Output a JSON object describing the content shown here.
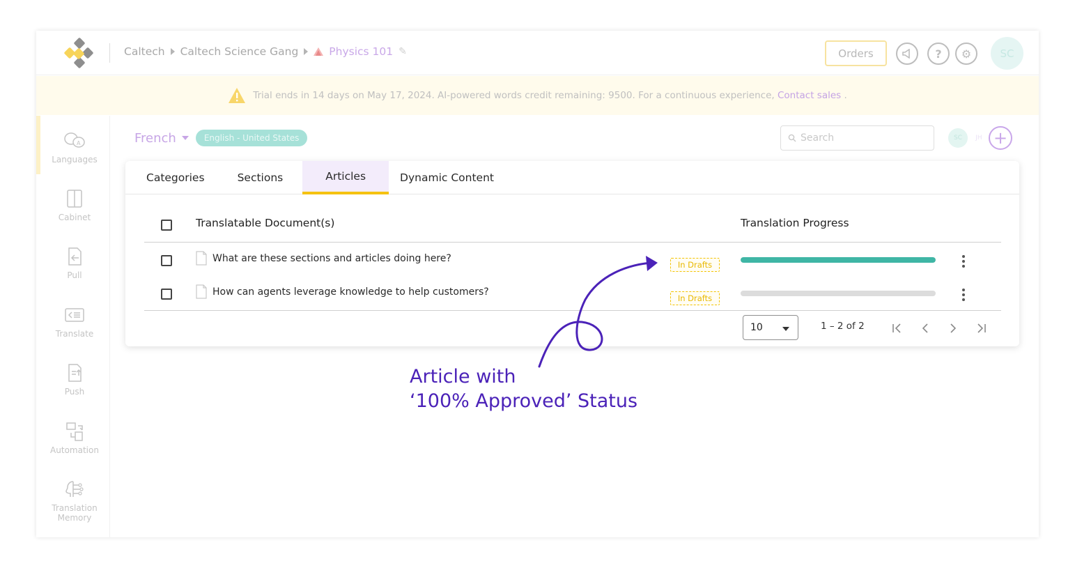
{
  "breadcrumb": {
    "items": [
      "Caltech",
      "Caltech Science Gang"
    ],
    "project": "Physics 101"
  },
  "header": {
    "orders_label": "Orders",
    "avatar_initials": "SC"
  },
  "banner": {
    "text": "Trial ends in 14 days on May 17, 2024. AI-powered words credit remaining: 9500. For a continuous experience,",
    "link": "Contact sales",
    "suffix": "."
  },
  "sidebar": {
    "items": [
      {
        "label": "Languages",
        "icon": "languages-icon"
      },
      {
        "label": "Cabinet",
        "icon": "cabinet-icon"
      },
      {
        "label": "Pull",
        "icon": "pull-icon"
      },
      {
        "label": "Translate",
        "icon": "translate-icon"
      },
      {
        "label": "Push",
        "icon": "push-icon"
      },
      {
        "label": "Automation",
        "icon": "automation-icon"
      },
      {
        "label": "Translation",
        "label2": "Memory",
        "icon": "translation-memory-icon"
      }
    ]
  },
  "language": {
    "name": "French",
    "source_pill": "English - United States"
  },
  "search": {
    "placeholder": "Search"
  },
  "collaborators": [
    "SC",
    "JH"
  ],
  "tabs": [
    {
      "label": "Categories"
    },
    {
      "label": "Sections"
    },
    {
      "label": "Articles"
    },
    {
      "label": "Dynamic Content"
    }
  ],
  "table": {
    "col_document": "Translatable Document(s)",
    "col_progress": "Translation Progress",
    "rows": [
      {
        "title": "What are these sections and articles doing here?",
        "status": "In Drafts",
        "progress": 100
      },
      {
        "title": "How can agents leverage knowledge to help customers?",
        "status": "In Drafts",
        "progress": 0
      }
    ]
  },
  "pager": {
    "page_size": "10",
    "range": "1 – 2 of 2"
  },
  "annotation": {
    "line1": "Article with",
    "line2": "‘100% Approved’ Status"
  },
  "colors": {
    "accent_purple": "#c7a6e6",
    "progress_teal": "#3fb6a5",
    "status_yellow": "#f3c300",
    "annotation_purple": "#4b22b8"
  }
}
